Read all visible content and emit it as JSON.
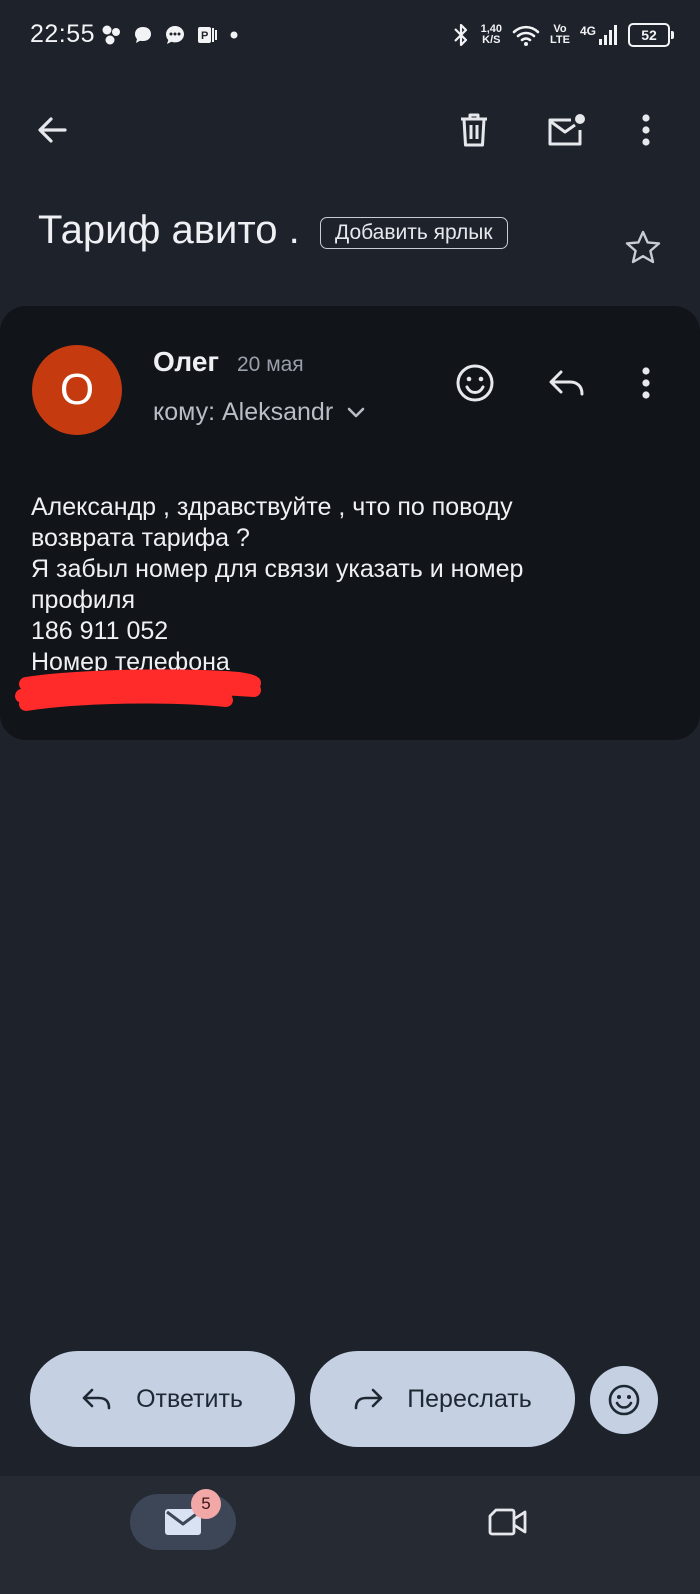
{
  "status_bar": {
    "time": "22:55",
    "net_speed_value": "1,40",
    "net_speed_unit": "K/S",
    "volte_top": "Vo",
    "volte_bottom": "LTE",
    "network": "4G",
    "battery": "52"
  },
  "app_bar": {
    "icons": [
      "back-arrow-icon",
      "trash-icon",
      "mark-unread-icon",
      "more-vert-icon"
    ]
  },
  "email": {
    "subject": "Тариф авито .",
    "add_label": "Добавить ярлык",
    "sender_name": "Олег",
    "avatar_letter": "О",
    "date": "20 мая",
    "recipient": "кому: Aleksandr",
    "body_lines": [
      "Александр , здравствуйте , что по поводу",
      "возврата тарифа ?",
      "Я забыл номер для связи указать и номер",
      "профиля",
      "186 911 052",
      "Номер телефона"
    ]
  },
  "actions": {
    "reply": "Ответить",
    "forward": "Переслать"
  },
  "bottom_nav": {
    "mail_badge": "5"
  },
  "colors": {
    "background": "#1e222b",
    "card": "#111418",
    "avatar": "#c63a10",
    "pill": "#c5d0e3",
    "badge": "#f3a8a8",
    "redaction": "#ff2a2a"
  }
}
